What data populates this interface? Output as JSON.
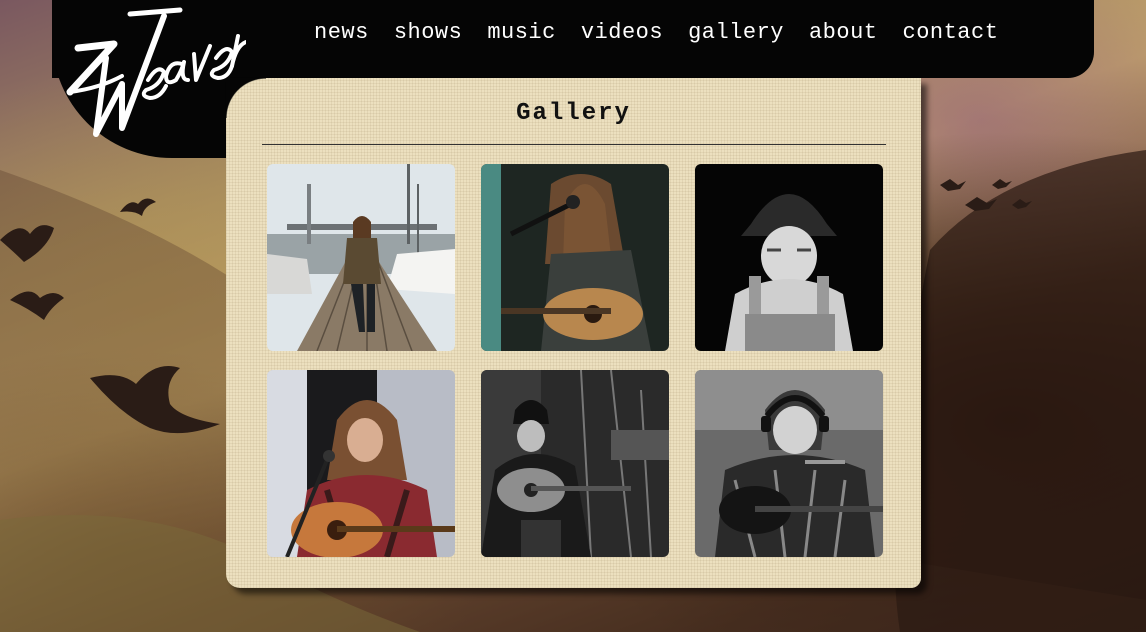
{
  "brand": {
    "logo_text": "Weaver"
  },
  "nav": {
    "items": [
      {
        "label": "news"
      },
      {
        "label": "shows"
      },
      {
        "label": "music"
      },
      {
        "label": "videos"
      },
      {
        "label": "gallery"
      },
      {
        "label": "about"
      },
      {
        "label": "contact"
      }
    ]
  },
  "page": {
    "title": "Gallery"
  },
  "gallery": {
    "photos": [
      {
        "subject": "man-on-dock-photo"
      },
      {
        "subject": "guitarist-with-microphone-photo"
      },
      {
        "subject": "man-in-bucket-hat-photo"
      },
      {
        "subject": "singer-with-acoustic-guitar-photo"
      },
      {
        "subject": "guitarist-in-beanie-photo"
      },
      {
        "subject": "guitarist-with-headphones-photo"
      }
    ]
  },
  "colors": {
    "header_bg": "#050505",
    "panel_bg": "#ece0bf",
    "nav_text": "#ffffff",
    "title_text": "#111111"
  }
}
